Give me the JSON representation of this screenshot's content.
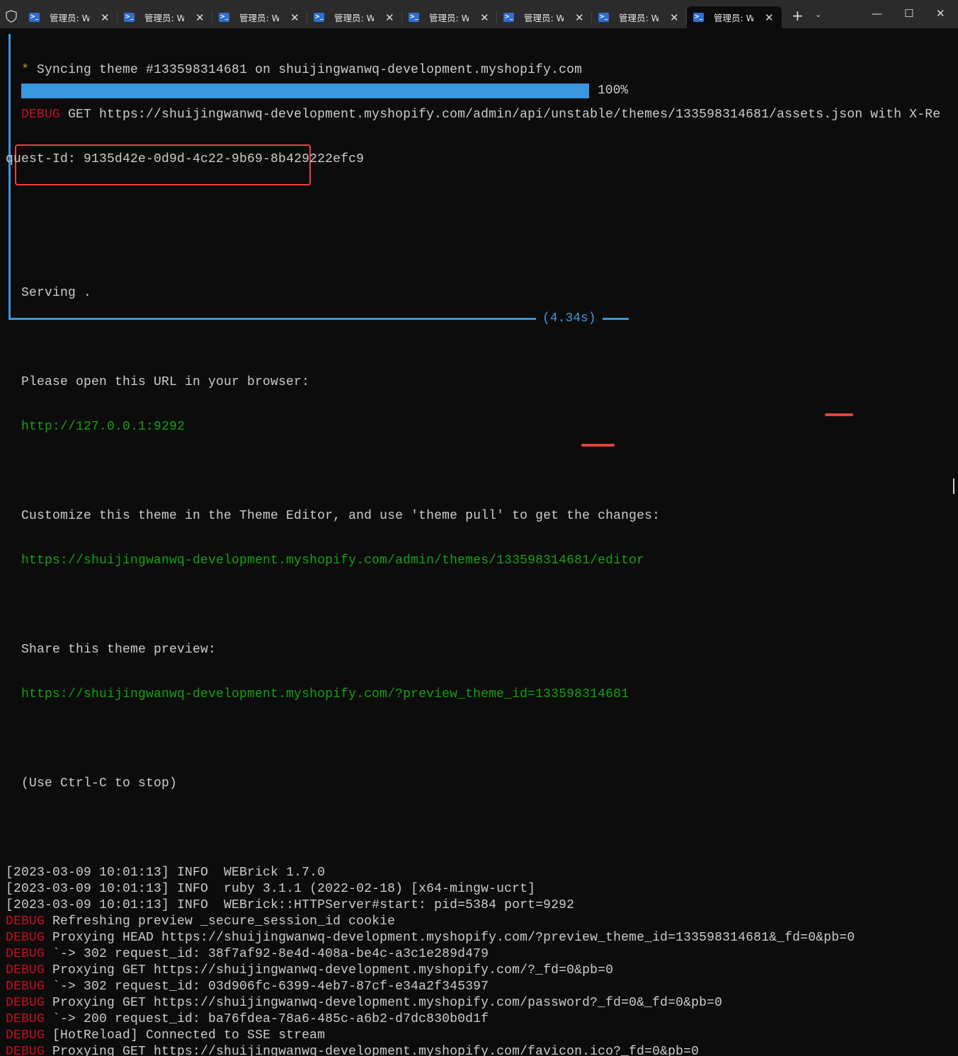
{
  "tabs": [
    {
      "label": "管理员: Windows PowerShell"
    },
    {
      "label": "管理员: Windows PowerShell"
    },
    {
      "label": "管理员: Windows PowerShell"
    },
    {
      "label": "管理员: Windows PowerShell"
    },
    {
      "label": "管理员: Windows PowerShell"
    },
    {
      "label": "管理员: Windows PowerShell"
    },
    {
      "label": "管理员: Windows PowerShell"
    },
    {
      "label": "管理员: Windows PowerShell",
      "active": true
    }
  ],
  "icons": {
    "tab": "powershell-icon",
    "close": "✕",
    "new_tab": "+",
    "dropdown": "⌄",
    "minimize": "—",
    "maximize": "☐",
    "close_window": "✕"
  },
  "box": {
    "sync_star": "*",
    "sync": " Syncing theme #133598314681 on shuijingwanwq-development.myshopify.com",
    "debug": "DEBUG",
    "get_line": " GET https://shuijingwanwq-development.myshopify.com/admin/api/unstable/themes/133598314681/assets.json with X-Re",
    "get_wrap": "quest-Id: 9135d42e-0d9d-4c22-9b69-8b429222efc9",
    "progress_percent": 100,
    "progress_label": "100%",
    "serving": "Serving .",
    "open_url_label": "Please open this URL in your browser:",
    "open_url": "http://127.0.0.1:9292",
    "customize_label": "Customize this theme in the Theme Editor, and use 'theme pull' to get the changes:",
    "customize_url": "https://shuijingwanwq-development.myshopify.com/admin/themes/133598314681/editor",
    "share_label": "Share this theme preview:",
    "share_url": "https://shuijingwanwq-development.myshopify.com/?preview_theme_id=133598314681",
    "stop": "(Use Ctrl-C to stop)",
    "elapsed": "(4.34s)"
  },
  "log": [
    {
      "level": "",
      "text": "[2023-03-09 10:01:13] INFO  WEBrick 1.7.0"
    },
    {
      "level": "",
      "text": "[2023-03-09 10:01:13] INFO  ruby 3.1.1 (2022-02-18) [x64-mingw-ucrt]"
    },
    {
      "level": "",
      "text": "[2023-03-09 10:01:13] INFO  WEBrick::HTTPServer#start: pid=5384 port=9292"
    },
    {
      "level": "DEBUG",
      "text": " Refreshing preview _secure_session_id cookie"
    },
    {
      "level": "DEBUG",
      "text": " Proxying HEAD https://shuijingwanwq-development.myshopify.com/?preview_theme_id=133598314681&_fd=0&pb=0"
    },
    {
      "level": "DEBUG",
      "text": " `-> 302 request_id: 38f7af92-8e4d-408a-be4c-a3c1e289d479"
    },
    {
      "level": "DEBUG",
      "text": " Proxying GET https://shuijingwanwq-development.myshopify.com/?_fd=0&pb=0"
    },
    {
      "level": "DEBUG",
      "text": " `-> 302 request_id: 03d906fc-6399-4eb7-87cf-e34a2f345397"
    },
    {
      "level": "DEBUG",
      "text": " Proxying GET https://shuijingwanwq-development.myshopify.com/password?_fd=0&_fd=0&pb=0"
    },
    {
      "level": "DEBUG",
      "text": " `-> 200 request_id: ba76fdea-78a6-485c-a6b2-d7dc830b0d1f"
    },
    {
      "level": "DEBUG",
      "text": " [HotReload] Connected to SSE stream"
    },
    {
      "level": "DEBUG",
      "text": " Proxying GET https://shuijingwanwq-development.myshopify.com/favicon.ico?_fd=0&pb=0"
    }
  ],
  "colors": {
    "accent": "#3a96dd",
    "debug": "#c50f1f",
    "url": "#13a10e",
    "highlight": "#e8413e"
  }
}
